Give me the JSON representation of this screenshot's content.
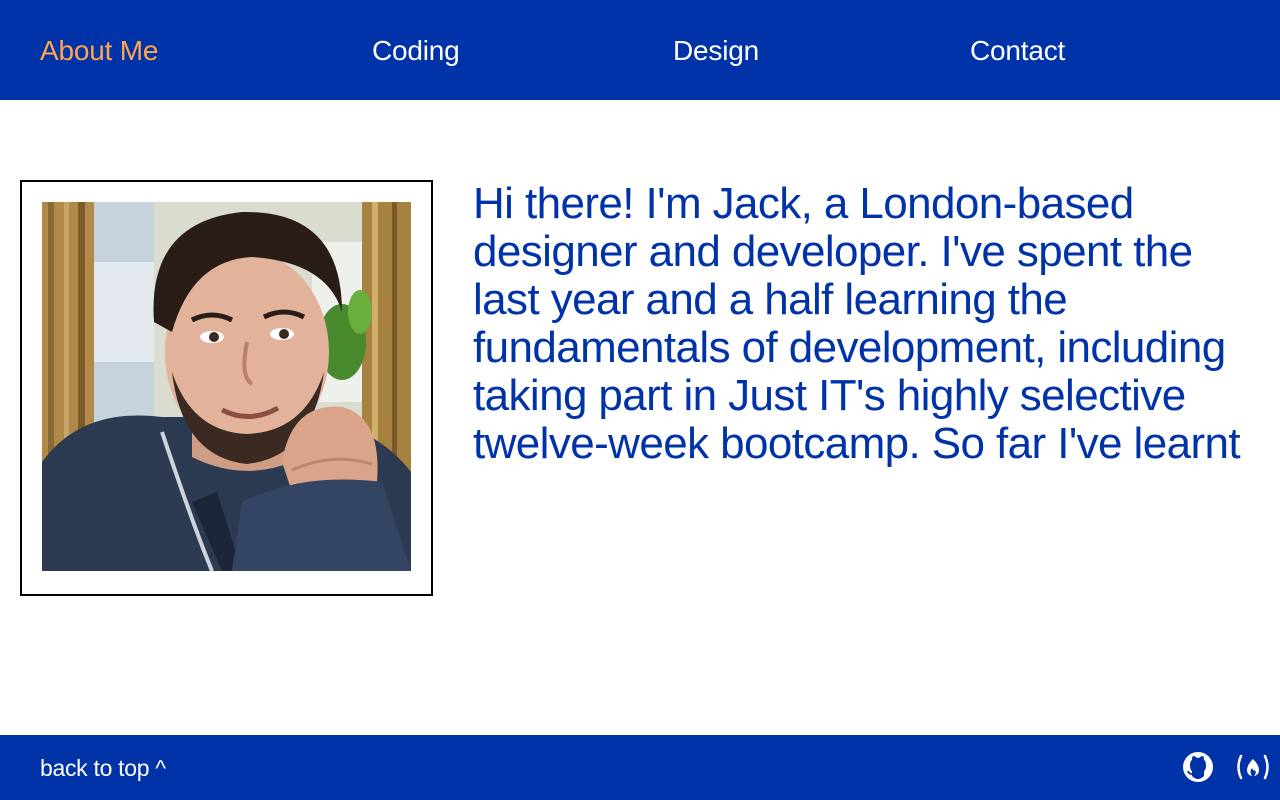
{
  "nav": {
    "items": [
      {
        "label": "About Me",
        "active": true
      },
      {
        "label": "Coding",
        "active": false
      },
      {
        "label": "Design",
        "active": false
      },
      {
        "label": "Contact",
        "active": false
      }
    ]
  },
  "main": {
    "photo": {
      "subject": "portrait photo of Jack"
    },
    "intro_text": "Hi there! I'm Jack, a London-based designer and developer. I've spent the last year and a half learning the fundamentals of development, including taking part in Just IT's highly selective twelve-week bootcamp. So far I've learnt"
  },
  "footer": {
    "back_to_top": "back to top ^",
    "icons": [
      "github-icon",
      "freecodecamp-icon"
    ]
  },
  "colors": {
    "brand_blue": "#0032a8",
    "active_nav": "#ffa64d",
    "text_on_brand": "#ffffff",
    "frame_border": "#000000"
  }
}
